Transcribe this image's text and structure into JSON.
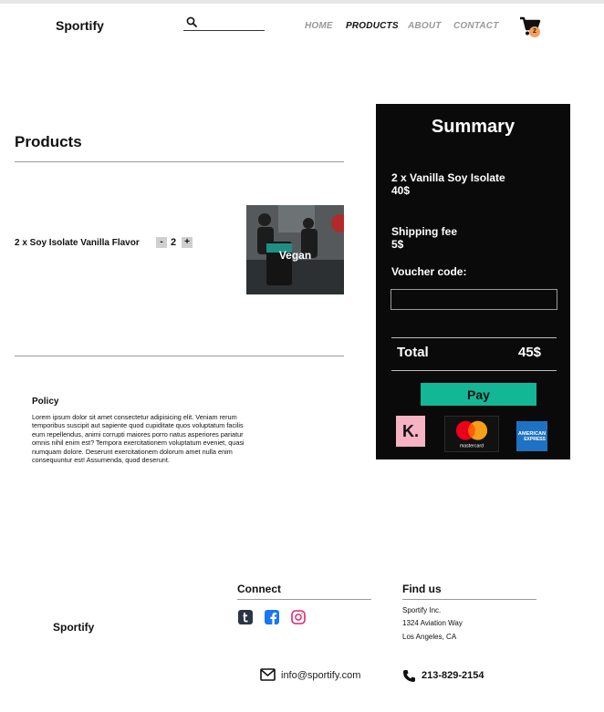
{
  "header": {
    "brand": "Sportify",
    "search": {
      "placeholder": "",
      "value": ""
    },
    "nav": [
      {
        "label": "HOME",
        "active": false
      },
      {
        "label": "PRODUCTS",
        "active": true
      },
      {
        "label": "ABOUT",
        "active": false
      },
      {
        "label": "CONTACT",
        "active": false
      }
    ],
    "cart_count": "2",
    "cart_badge_color": "#f6a05a"
  },
  "products": {
    "title": "Products",
    "items": [
      {
        "name": "2 x Soy Isolate Vanilla Flavor",
        "quantity": "2",
        "decrement_label": "-",
        "increment_label": "+",
        "image_label": "Vegan"
      }
    ]
  },
  "policy": {
    "title": "Policy",
    "text": "Lorem ipsum dolor sit amet consectetur adipisicing elit. Veniam rerum temporibus suscipit aut sapiente quod cupiditate quos voluptatum facilis eum repellendus, animi corrupti maiores porro natus asperiores pariatur omnis nihil enim est? Tempora exercitationem voluptatum eveniet, quasi numquam dolore. Deserunt exercitationem dolorum amet nulla enim consequuntur est! Assumenda, quod deserunt."
  },
  "summary": {
    "title": "Summary",
    "item_line": "2 x Vanilla Soy Isolate",
    "item_price": "40$",
    "shipping_label": "Shipping fee",
    "shipping_price": "5$",
    "voucher_label": "Voucher code:",
    "voucher_value": "",
    "total_label": "Total",
    "total_value": "45$",
    "pay_label": "Pay",
    "pay_color": "#14b795",
    "payment_logos": {
      "klarna": "K.",
      "mastercard": "mastercard",
      "amex_line1": "AMERICAN",
      "amex_line2": "EXPRESS"
    }
  },
  "footer": {
    "brand": "Sportify",
    "connect_title": "Connect",
    "social_icons": [
      "tumblr-icon",
      "facebook-icon",
      "instagram-icon"
    ],
    "findus_title": "Find us",
    "address_lines": [
      "Sportify Inc.",
      "1324 Aviation Way",
      "Los Angeles, CA"
    ],
    "email": "info@sportify.com",
    "phone": "213-829-2154"
  }
}
